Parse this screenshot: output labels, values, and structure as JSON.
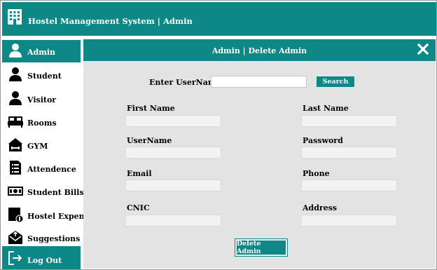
{
  "app": {
    "title": "Hostel Management System | Admin"
  },
  "sidebar": {
    "items": [
      {
        "label": "Admin",
        "icon": "person-icon",
        "active": true
      },
      {
        "label": "Student",
        "icon": "person-icon"
      },
      {
        "label": "Visitor",
        "icon": "person-icon"
      },
      {
        "label": "Rooms",
        "icon": "bed-icon"
      },
      {
        "label": "GYM",
        "icon": "dumbbell-icon"
      },
      {
        "label": "Attendence",
        "icon": "clipboard-icon"
      },
      {
        "label": "Student Bills",
        "icon": "money-icon"
      },
      {
        "label": "Hostel Expense",
        "icon": "expense-icon"
      },
      {
        "label": "Suggestions",
        "icon": "envelope-icon"
      },
      {
        "label": "Log Out",
        "icon": "logout-icon",
        "active": true
      }
    ]
  },
  "panel": {
    "title": "Admin | Delete Admin",
    "search": {
      "label": "Enter UserName",
      "value": "",
      "button": "Search"
    },
    "fields": {
      "first_name": {
        "label": "First Name",
        "value": ""
      },
      "last_name": {
        "label": "Last Name",
        "value": ""
      },
      "username": {
        "label": "UserName",
        "value": ""
      },
      "password": {
        "label": "Password",
        "value": ""
      },
      "email": {
        "label": "Email",
        "value": ""
      },
      "phone": {
        "label": "Phone",
        "value": ""
      },
      "cnic": {
        "label": "CNIC",
        "value": ""
      },
      "address": {
        "label": "Address",
        "value": ""
      }
    },
    "delete_button": "Delete Admin"
  },
  "colors": {
    "accent": "#0e8787",
    "panel_bg": "#e3e3e3"
  }
}
